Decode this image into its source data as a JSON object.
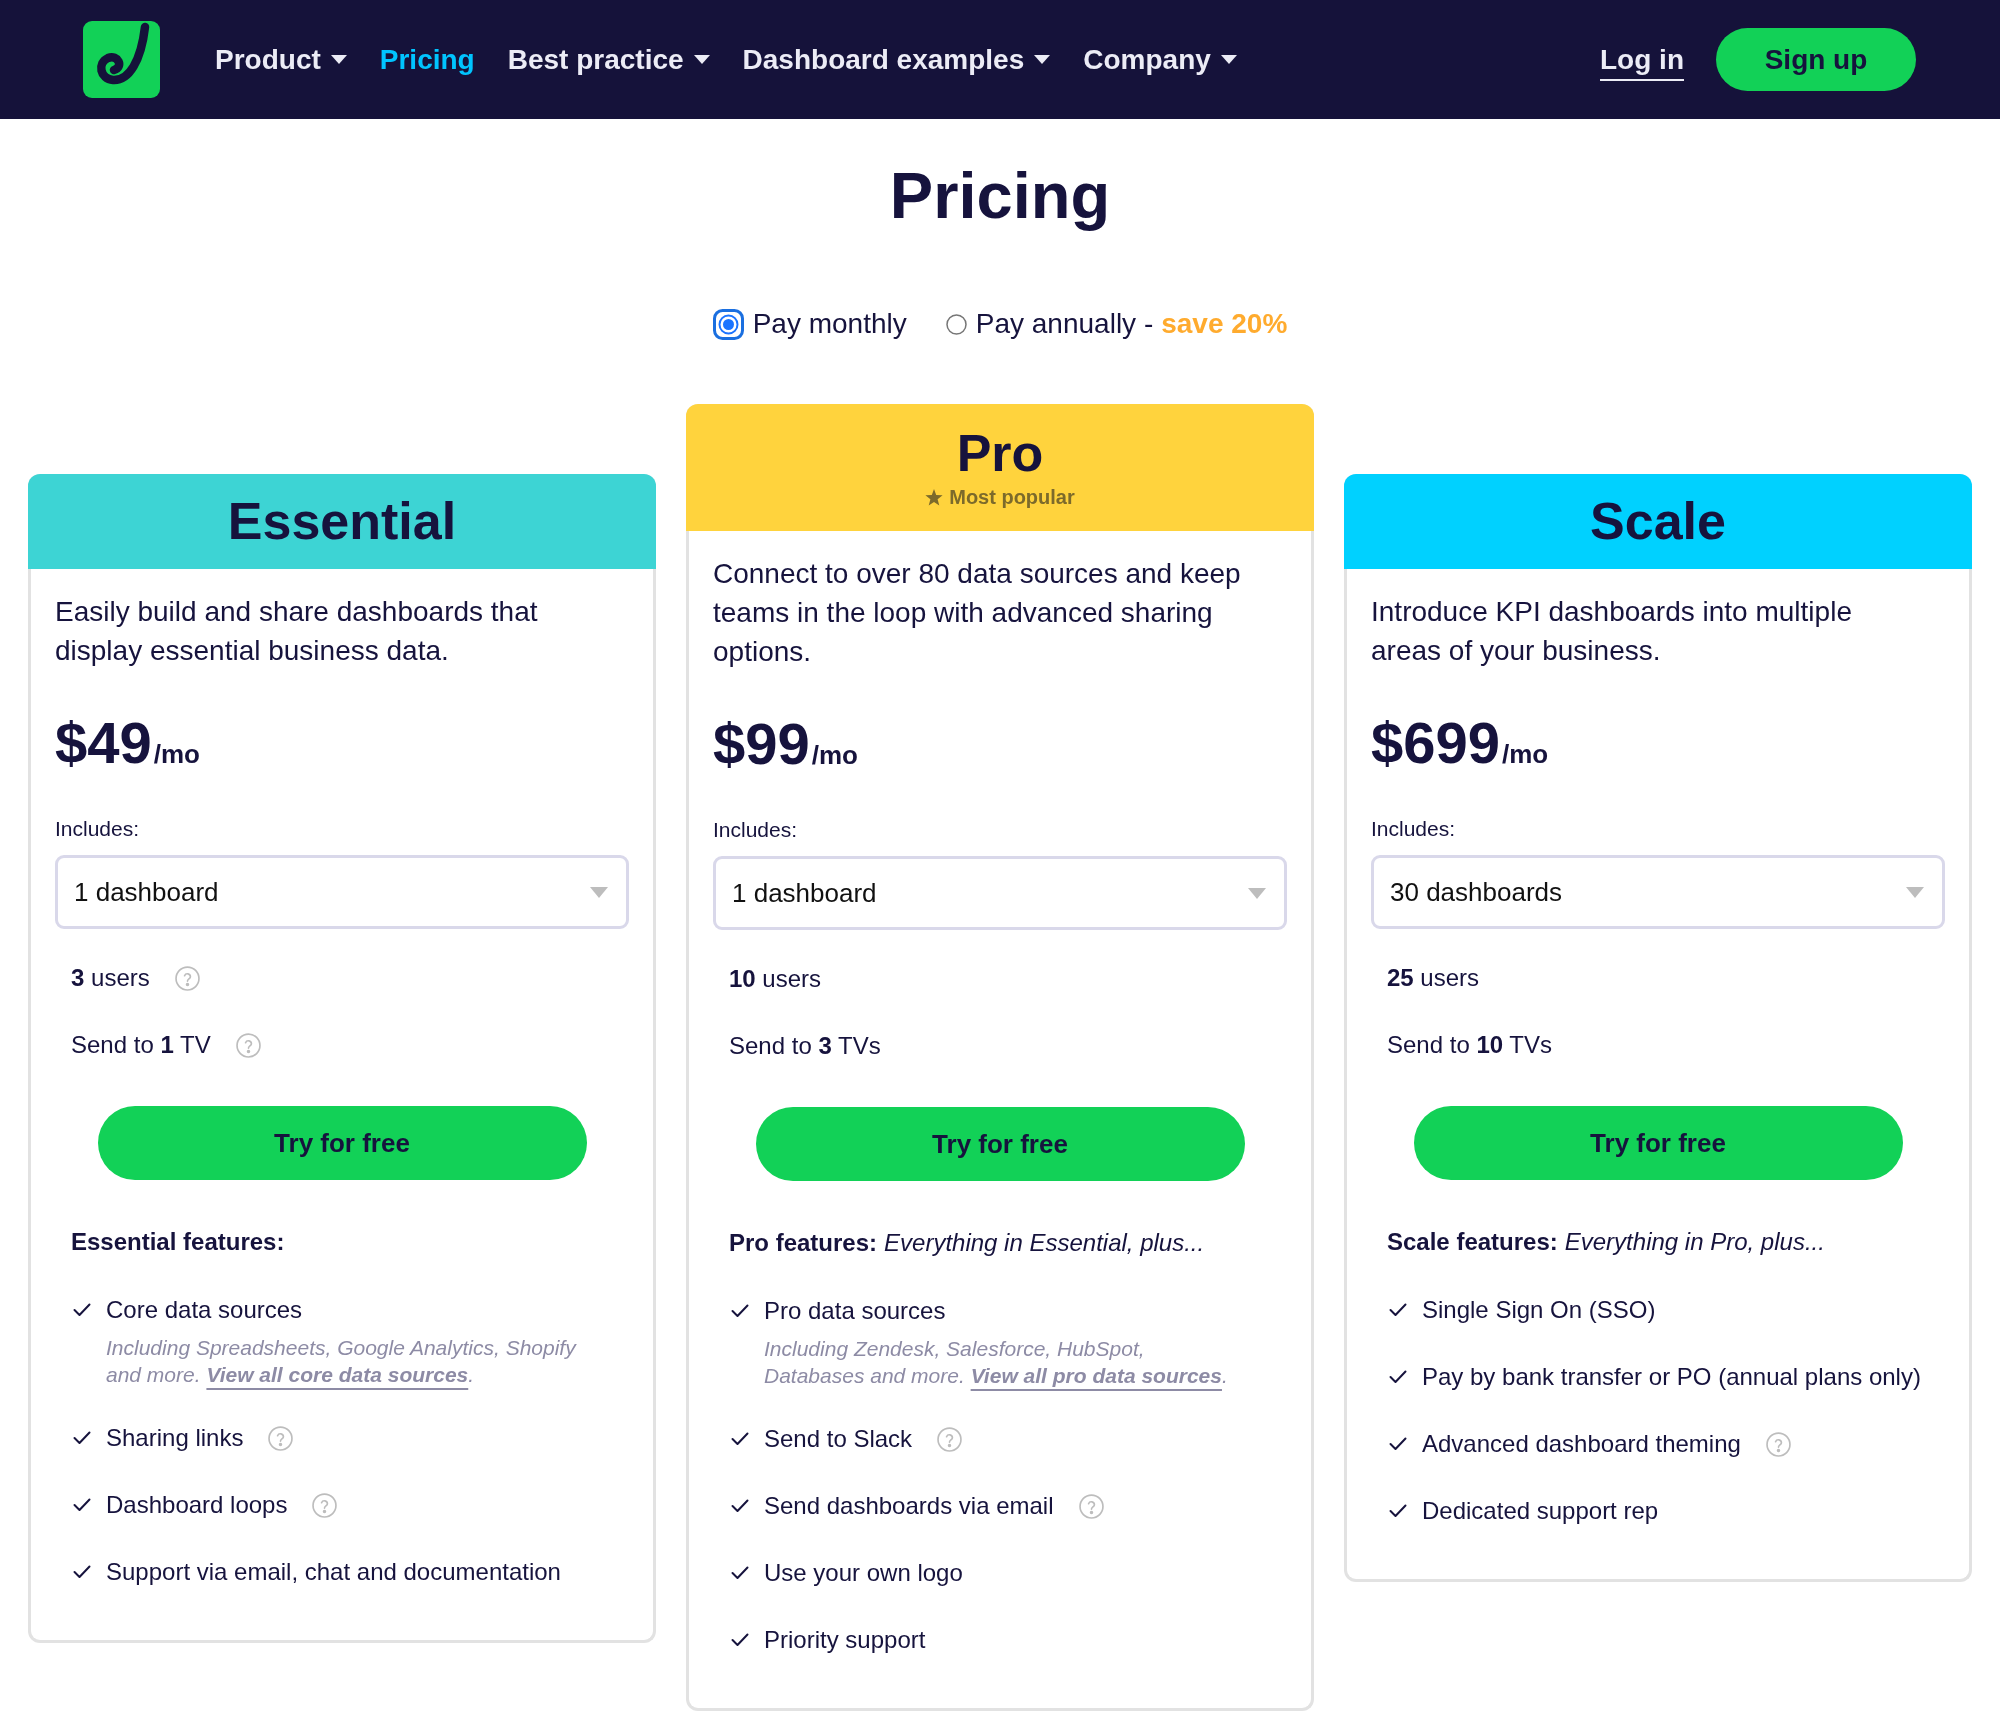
{
  "nav": {
    "items": [
      {
        "label": "Product",
        "dropdown": true,
        "selected": false
      },
      {
        "label": "Pricing",
        "dropdown": false,
        "selected": true
      },
      {
        "label": "Best practice",
        "dropdown": true,
        "selected": false
      },
      {
        "label": "Dashboard examples",
        "dropdown": true,
        "selected": false
      },
      {
        "label": "Company",
        "dropdown": true,
        "selected": false
      }
    ],
    "login": "Log in",
    "signup": "Sign up"
  },
  "title": "Pricing",
  "billing": [
    {
      "label": "Pay monthly",
      "selected": true
    },
    {
      "label": "Pay annually -",
      "offer": "save 20%",
      "selected": false
    }
  ],
  "plans": [
    {
      "name": "Essential",
      "color": "#3dd4d4",
      "description": "Easily build and share dashboards that display essential business data.",
      "price": "$49",
      "period": "/mo",
      "includes_label": "Includes:",
      "dashboards": "1 dashboard",
      "limits": [
        {
          "text": "**3** users",
          "help": true
        },
        {
          "text": "Send to **1** TV",
          "help": true
        }
      ],
      "cta": "Try for free",
      "features_heading": {
        "title": "Essential features:"
      },
      "features": [
        {
          "text": "Core data sources",
          "help": false,
          "note": {
            "lines": [
              "Including Spreadsheets, Google Analytics, Shopify",
              "and more."
            ],
            "link": "View all core data sources",
            "end": "."
          }
        },
        {
          "text": "Sharing links",
          "help": true
        },
        {
          "text": "Dashboard loops",
          "help": true
        },
        {
          "text": "Support via email, chat and documentation",
          "help": false
        }
      ]
    },
    {
      "name": "Pro",
      "badge": "Most popular",
      "color": "#ffd33d",
      "description": "Connect to over 80 data sources and keep teams in the loop with advanced sharing options.",
      "price": "$99",
      "period": "/mo",
      "includes_label": "Includes:",
      "dashboards": "1 dashboard",
      "limits": [
        {
          "text": "**10** users",
          "help": false
        },
        {
          "text": "Send to **3** TVs",
          "help": false
        }
      ],
      "cta": "Try for free",
      "features_heading": {
        "title": "Pro features:",
        "note": "Everything in Essential, plus..."
      },
      "features": [
        {
          "text": "Pro data sources",
          "help": false,
          "note": {
            "lines": [
              "Including Zendesk, Salesforce, HubSpot,",
              "Databases and more."
            ],
            "link": "View all pro data sources",
            "end": "."
          }
        },
        {
          "text": "Send to Slack",
          "help": true
        },
        {
          "text": "Send dashboards via email",
          "help": true
        },
        {
          "text": "Use your own logo",
          "help": false
        },
        {
          "text": "Priority support",
          "help": false
        }
      ]
    },
    {
      "name": "Scale",
      "color": "#00d1ff",
      "description": "Introduce KPI dashboards into multiple areas of your business.",
      "price": "$699",
      "period": "/mo",
      "includes_label": "Includes:",
      "dashboards": "30 dashboards",
      "limits": [
        {
          "text": "**25** users",
          "help": false
        },
        {
          "text": "Send to **10** TVs",
          "help": false
        }
      ],
      "cta": "Try for free",
      "features_heading": {
        "title": "Scale features:",
        "note": "Everything in Pro, plus..."
      },
      "features": [
        {
          "text": "Single Sign On (SSO)",
          "help": false
        },
        {
          "text": "Pay by bank transfer or PO (annual plans only)",
          "help": false
        },
        {
          "text": "Advanced dashboard theming",
          "help": true
        },
        {
          "text": "Dedicated support rep",
          "help": false
        }
      ]
    }
  ]
}
